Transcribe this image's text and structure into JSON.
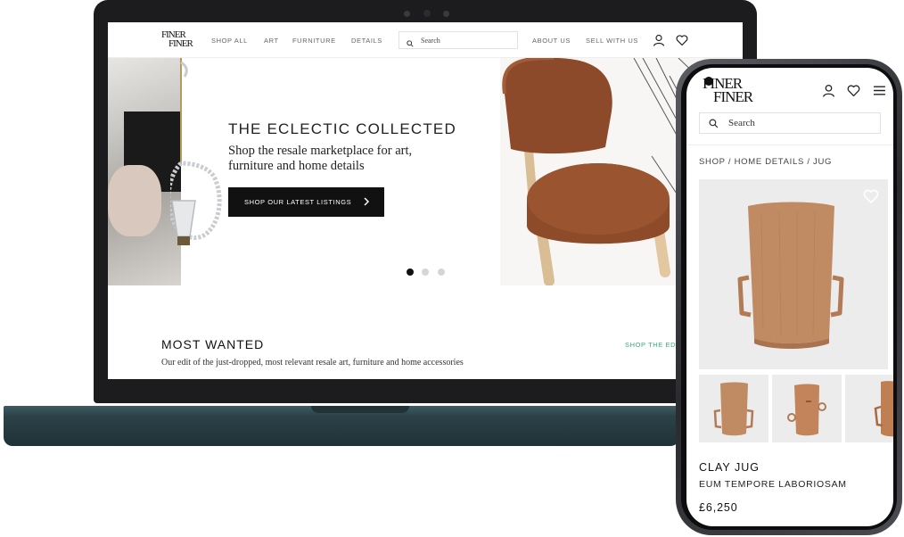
{
  "brand": {
    "logo_line1": "FINER",
    "logo_line2": "FINER"
  },
  "desktop": {
    "nav": {
      "items": [
        "SHOP ALL",
        "ART",
        "FURNITURE",
        "DETAILS"
      ],
      "search_placeholder": "Search",
      "right_items": [
        "ABOUT US",
        "SELL WITH US"
      ]
    },
    "hero": {
      "title": "THE ECLECTIC COLLECTED",
      "subtitle": "Shop the resale marketplace for art, furniture and home details",
      "button_label": "SHOP OUR LATEST LISTINGS",
      "carousel_slides": 3,
      "active_slide": 1
    },
    "most_wanted": {
      "title": "MOST WANTED",
      "subtitle": "Our edit of the just-dropped, most relevant resale art, furniture and home accessories",
      "link": "SHOP THE ED"
    }
  },
  "mobile": {
    "search_placeholder": "Search",
    "breadcrumb": "SHOP / HOME DETAILS / JUG",
    "product": {
      "name": "CLAY JUG",
      "description": "EUM TEMPORE LABORIOSAM",
      "price": "£6,250"
    }
  },
  "colors": {
    "accent_green": "#3aa87a",
    "button_black": "#111111",
    "clay": "#c08a63",
    "laptop_base": "#2b4248"
  },
  "icons": [
    "search-icon",
    "user-icon",
    "heart-icon",
    "menu-icon",
    "chevron-right-icon"
  ]
}
